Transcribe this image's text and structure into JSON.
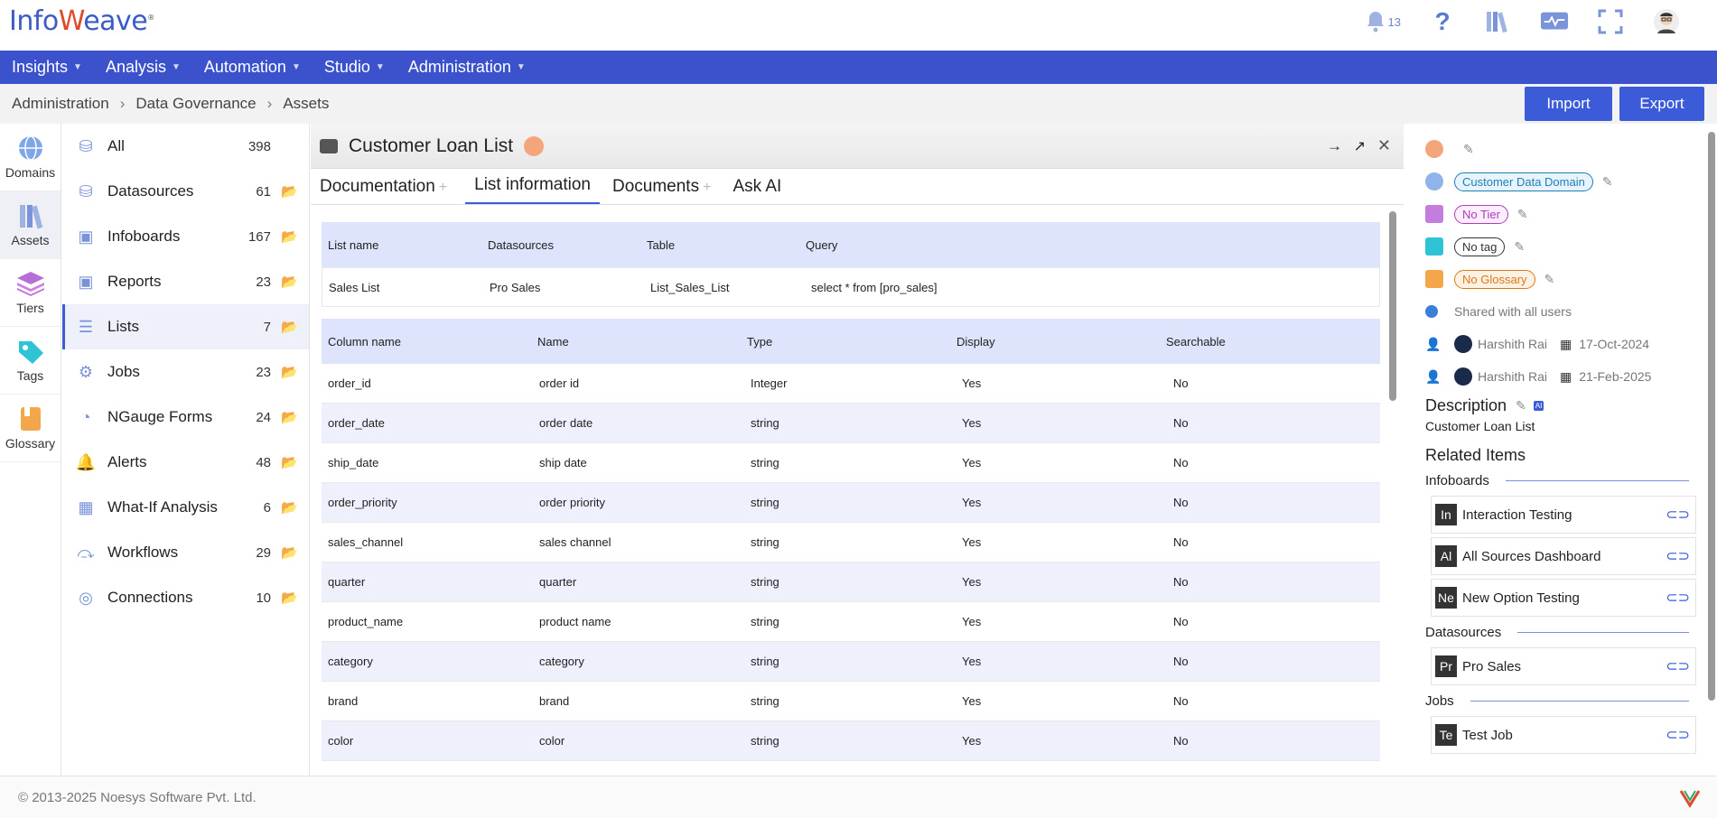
{
  "brand": {
    "logo_prefix": "Info",
    "logo_w": "W",
    "logo_suffix": "eave",
    "registered": "®"
  },
  "notifications": {
    "count": "13"
  },
  "nav": [
    "Insights",
    "Analysis",
    "Automation",
    "Studio",
    "Administration"
  ],
  "breadcrumb": [
    "Administration",
    "Data Governance",
    "Assets"
  ],
  "actions": {
    "import": "Import",
    "export": "Export"
  },
  "rail": [
    {
      "label": "Domains",
      "icon": "globe-icon"
    },
    {
      "label": "Assets",
      "icon": "books-icon"
    },
    {
      "label": "Tiers",
      "icon": "layers-icon"
    },
    {
      "label": "Tags",
      "icon": "tag-icon"
    },
    {
      "label": "Glossary",
      "icon": "book-icon"
    }
  ],
  "categories": [
    {
      "label": "All",
      "count": "398",
      "icon": "database-add-icon"
    },
    {
      "label": "Datasources",
      "count": "61",
      "icon": "database-icon"
    },
    {
      "label": "Infoboards",
      "count": "167",
      "icon": "dashboard-icon"
    },
    {
      "label": "Reports",
      "count": "23",
      "icon": "report-icon"
    },
    {
      "label": "Lists",
      "count": "7",
      "icon": "list-icon"
    },
    {
      "label": "Jobs",
      "count": "23",
      "icon": "gears-icon"
    },
    {
      "label": "NGauge Forms",
      "count": "24",
      "icon": "gauge-icon"
    },
    {
      "label": "Alerts",
      "count": "48",
      "icon": "bell-icon"
    },
    {
      "label": "What-If Analysis",
      "count": "6",
      "icon": "grid-icon"
    },
    {
      "label": "Workflows",
      "count": "29",
      "icon": "workflow-icon"
    },
    {
      "label": "Connections",
      "count": "10",
      "icon": "globe-icon"
    }
  ],
  "panel": {
    "title": "Customer Loan List",
    "tabs": [
      {
        "label": "Documentation",
        "plus": "+"
      },
      {
        "label": "List information",
        "plus": ""
      },
      {
        "label": "Documents",
        "plus": "+"
      },
      {
        "label": "Ask AI",
        "plus": ""
      }
    ]
  },
  "list_info": {
    "headers": [
      "List name",
      "Datasources",
      "Table",
      "Query"
    ],
    "values": [
      "Sales List",
      "Pro Sales",
      "List_Sales_List",
      "select * from [pro_sales]"
    ]
  },
  "columns": {
    "headers": [
      "Column name",
      "Name",
      "Type",
      "Display",
      "Searchable"
    ],
    "rows": [
      [
        "order_id",
        "order id",
        "Integer",
        "Yes",
        "No"
      ],
      [
        "order_date",
        "order date",
        "string",
        "Yes",
        "No"
      ],
      [
        "ship_date",
        "ship date",
        "string",
        "Yes",
        "No"
      ],
      [
        "order_priority",
        "order priority",
        "string",
        "Yes",
        "No"
      ],
      [
        "sales_channel",
        "sales channel",
        "string",
        "Yes",
        "No"
      ],
      [
        "quarter",
        "quarter",
        "string",
        "Yes",
        "No"
      ],
      [
        "product_name",
        "product name",
        "string",
        "Yes",
        "No"
      ],
      [
        "category",
        "category",
        "string",
        "Yes",
        "No"
      ],
      [
        "brand",
        "brand",
        "string",
        "Yes",
        "No"
      ],
      [
        "color",
        "color",
        "string",
        "Yes",
        "No"
      ]
    ]
  },
  "details": {
    "domain": "Customer Data Domain",
    "tier": "No Tier",
    "tag": "No tag",
    "glossary": "No Glossary",
    "shared": "Shared with all users",
    "created_by": "Harshith Rai",
    "created_on": "17-Oct-2024",
    "modified_by": "Harshith Rai",
    "modified_on": "21-Feb-2025",
    "description_label": "Description",
    "ai_badge": "AI",
    "description": "Customer Loan List",
    "related_label": "Related Items",
    "groups": [
      {
        "name": "Infoboards",
        "items": [
          {
            "abbr": "In",
            "label": "Interaction Testing"
          },
          {
            "abbr": "Al",
            "label": "All Sources Dashboard"
          },
          {
            "abbr": "Ne",
            "label": "New Option Testing"
          }
        ]
      },
      {
        "name": "Datasources",
        "items": [
          {
            "abbr": "Pr",
            "label": "Pro Sales"
          }
        ]
      },
      {
        "name": "Jobs",
        "items": [
          {
            "abbr": "Te",
            "label": "Test Job"
          }
        ]
      }
    ]
  },
  "footer": "© 2013-2025 Noesys Software Pvt. Ltd.",
  "colors": {
    "nav": "#3b52cc",
    "accent": "#3b5bd9",
    "header_row": "#dde4fb",
    "alt_row": "#eef1fc"
  }
}
